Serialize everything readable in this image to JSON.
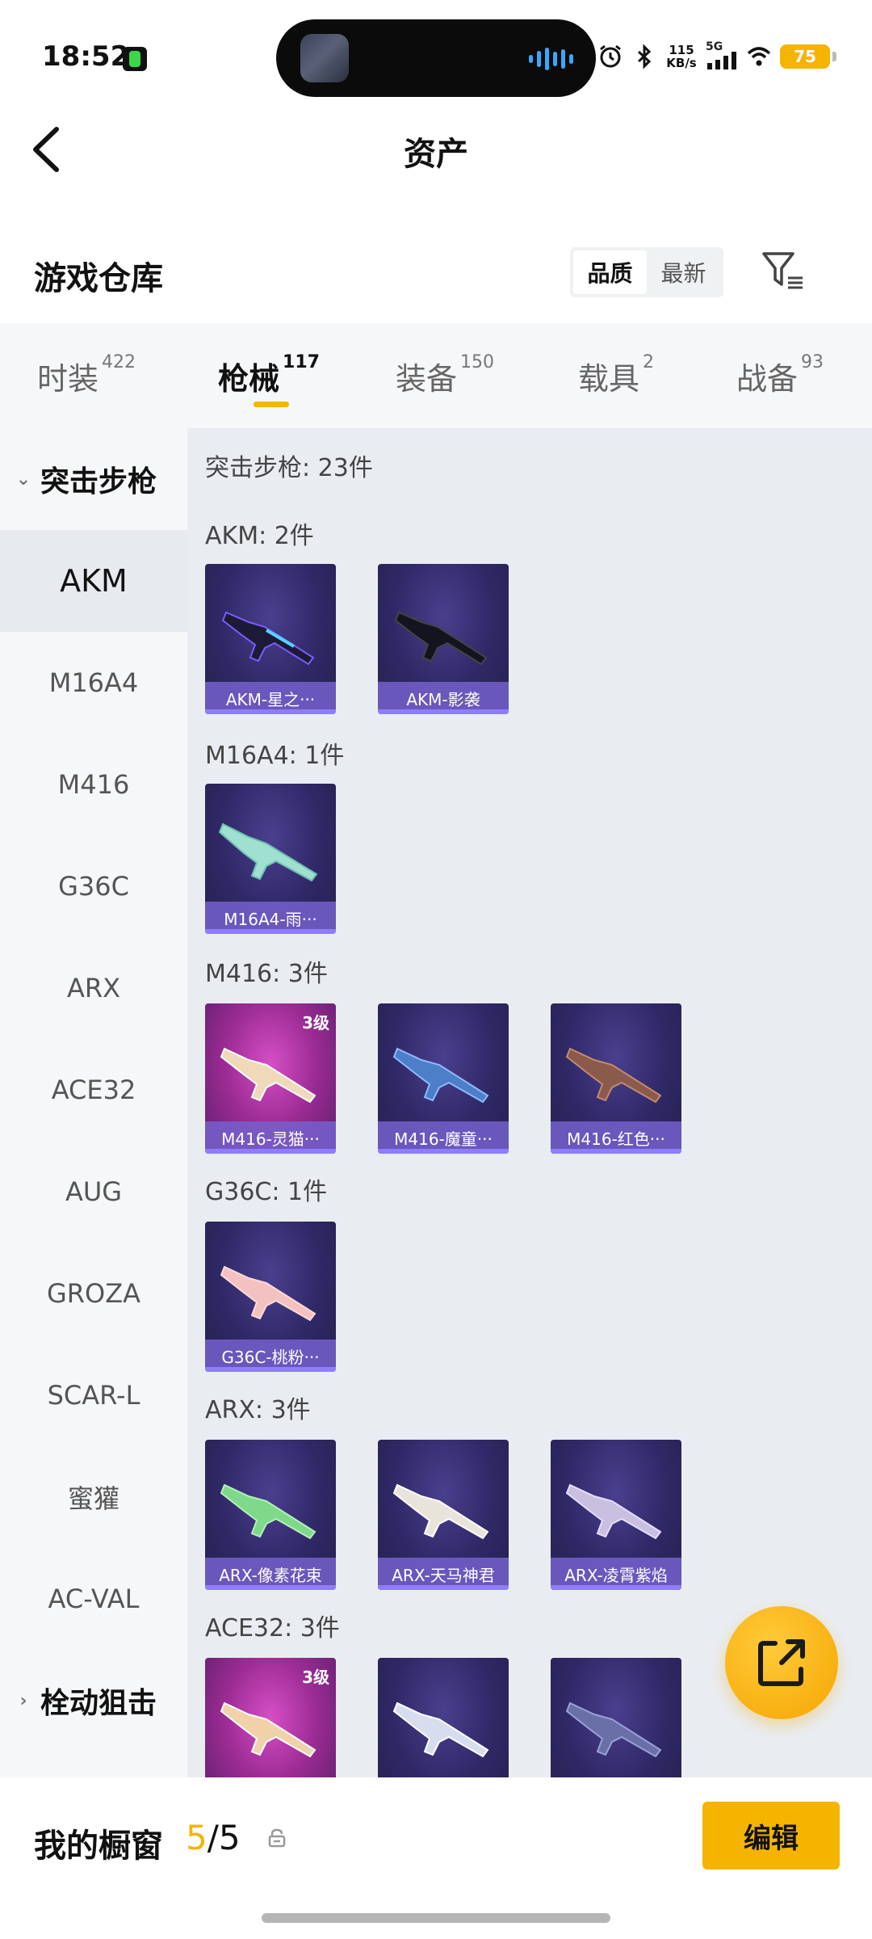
{
  "status_bar": {
    "time": "18:52",
    "net_speed_value": "115",
    "net_speed_unit": "KB/s",
    "network": "5G",
    "battery": "75"
  },
  "header": {
    "title": "资产"
  },
  "warehouse": {
    "title": "游戏仓库",
    "sort_options": [
      "品质",
      "最新"
    ],
    "sort_selected": "品质"
  },
  "tabs": [
    {
      "label": "时装",
      "count": "422"
    },
    {
      "label": "枪械",
      "count": "117",
      "active": true
    },
    {
      "label": "装备",
      "count": "150"
    },
    {
      "label": "载具",
      "count": "2"
    },
    {
      "label": "战备",
      "count": "93"
    }
  ],
  "sidebar": {
    "group_open": "突击步枪",
    "items": [
      "AKM",
      "M16A4",
      "M416",
      "G36C",
      "ARX",
      "ACE32",
      "AUG",
      "GROZA",
      "SCAR-L",
      "蜜獾",
      "AC-VAL"
    ],
    "selected": "AKM",
    "group_collapsed": "栓动狙击"
  },
  "content": {
    "category_title": "突击步枪: 23件",
    "groups": [
      {
        "title": "AKM: 2件",
        "items": [
          {
            "name": "AKM-星之···"
          },
          {
            "name": "AKM-影袭"
          }
        ]
      },
      {
        "title": "M16A4: 1件",
        "items": [
          {
            "name": "M16A4-雨···"
          }
        ]
      },
      {
        "title": "M416: 3件",
        "items": [
          {
            "name": "M416-灵猫···",
            "level": "3级"
          },
          {
            "name": "M416-魔童···"
          },
          {
            "name": "M416-红色···"
          }
        ]
      },
      {
        "title": "G36C: 1件",
        "items": [
          {
            "name": "G36C-桃粉···"
          }
        ]
      },
      {
        "title": "ARX: 3件",
        "items": [
          {
            "name": "ARX-像素花束"
          },
          {
            "name": "ARX-天马神君"
          },
          {
            "name": "ARX-凌霄紫焰"
          }
        ]
      },
      {
        "title": "ACE32: 3件",
        "items": [
          {
            "name": "",
            "level": "3级"
          },
          {
            "name": ""
          },
          {
            "name": ""
          }
        ]
      }
    ]
  },
  "showcase": {
    "title": "我的橱窗",
    "current": "5",
    "separator": "/",
    "total": "5",
    "edit_label": "编辑"
  },
  "colors": {
    "accent": "#f5b400",
    "card_purple": "#2f2866",
    "card_pink": "#9b2b93",
    "content_bg": "#e9edf2",
    "sidebar_bg": "#f6f7f9"
  }
}
